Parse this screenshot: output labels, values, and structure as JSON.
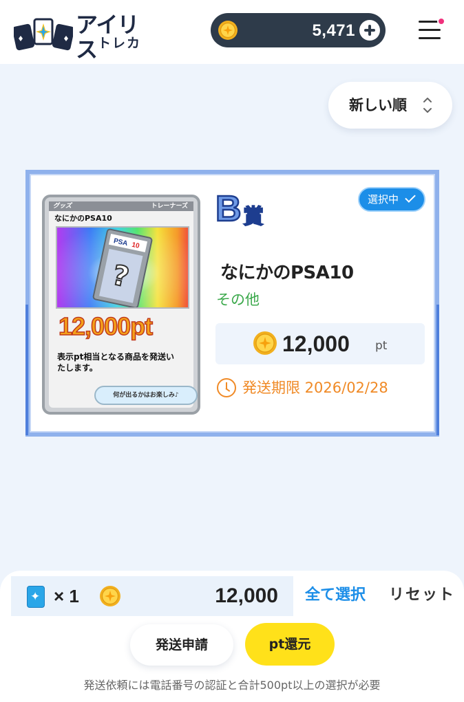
{
  "header": {
    "logo_title": "アイリス",
    "logo_sub": "トレカ",
    "points_balance": "5,471"
  },
  "sort": {
    "label": "新しい順"
  },
  "item": {
    "prize_rank": "B賞",
    "selected_label": "選択中",
    "name": "なにかのPSA10",
    "category": "その他",
    "price": "12,000",
    "price_unit": "pt",
    "deadline": "発送期限 2026/02/28",
    "card": {
      "tag_goods": "グッズ",
      "tag_trainer": "トレーナーズ",
      "name": "なにかのPSA10",
      "points": "12,000pt",
      "description": "表示pt相当となる商品を発送いたします。",
      "button": "何が出るかはお楽しみ♪",
      "slab_grade": "PSA 10"
    }
  },
  "summary": {
    "count": "× 1",
    "total": "12,000",
    "select_all": "全て選択",
    "reset": "リセット"
  },
  "actions": {
    "ship": "発送申請",
    "return": "pt還元"
  },
  "notice": "発送依頼には電話番号の認証と合計500pt以上の選択が必要",
  "colors": {
    "accent_blue": "#1c8ee8",
    "return_yellow": "#ffe11a",
    "deadline_orange": "#f08a26",
    "category_green": "#3aa84a",
    "points_pill": "#2e3b4a"
  }
}
